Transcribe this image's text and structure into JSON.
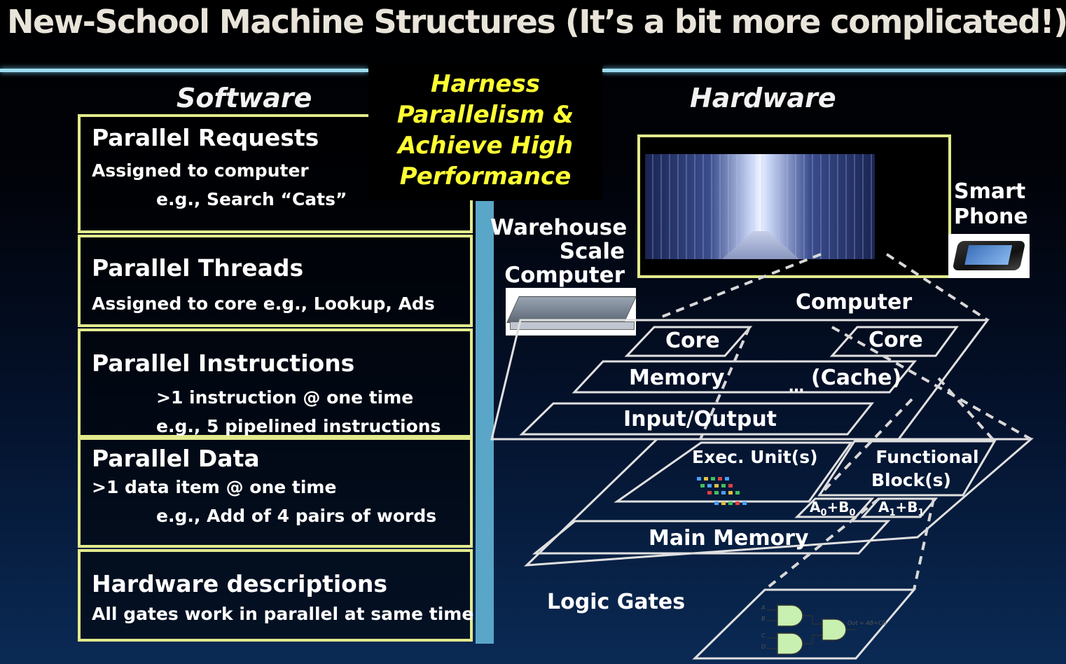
{
  "title": "New-School Machine Structures (It’s a bit more complicated!)",
  "software": {
    "heading": "Software",
    "boxes": [
      {
        "heading": "Parallel Requests",
        "line1": "Assigned to computer",
        "line2": "e.g., Search “Cats”"
      },
      {
        "heading": "Parallel Threads",
        "line1": "Assigned to core e.g., Lookup, Ads",
        "line2": ""
      },
      {
        "heading": "Parallel Instructions",
        "line1": ">1 instruction @ one time",
        "line2": "e.g., 5 pipelined instructions"
      },
      {
        "heading": "Parallel Data",
        "line1": ">1 data item @ one time",
        "line2": "e.g., Add of 4 pairs of words"
      },
      {
        "heading": "Hardware descriptions",
        "line1": "All gates work in parallel at same time",
        "line2": ""
      }
    ]
  },
  "callout": {
    "line1": "Harness",
    "line2": "Parallelism &",
    "line3": "Achieve High",
    "line4": "Performance"
  },
  "hardware": {
    "heading": "Hardware",
    "smart_phone": {
      "line1": "Smart",
      "line2": "Phone"
    },
    "warehouse": {
      "line1": "Warehouse",
      "line2": "Scale",
      "line3": "Computer"
    },
    "computer": "Computer",
    "core_left": "Core",
    "core_right": "Core",
    "memory": "Memory",
    "cache": "(Cache)",
    "ellipsis": "…",
    "io": "Input/Output",
    "exec_units": "Exec. Unit(s)",
    "functional_block": {
      "line1": "Functional",
      "line2": "Block(s)"
    },
    "a0b0": {
      "a": "A",
      "a_sub": "0",
      "plus": "+B",
      "b_sub": "0"
    },
    "a1b1": {
      "a": "A",
      "a_sub": "1",
      "plus": "+B",
      "b_sub": "1"
    },
    "main_memory": "Main Memory",
    "logic_gates": "Logic Gates",
    "gate_inputs": [
      "A",
      "B",
      "C",
      "D"
    ],
    "gate_output": "Out = AB+CD"
  },
  "colors": {
    "box_border": "#e2ea8c",
    "callout_text": "#ffff33",
    "bar": "#5aa6c8",
    "rule": "#9fdcef"
  }
}
